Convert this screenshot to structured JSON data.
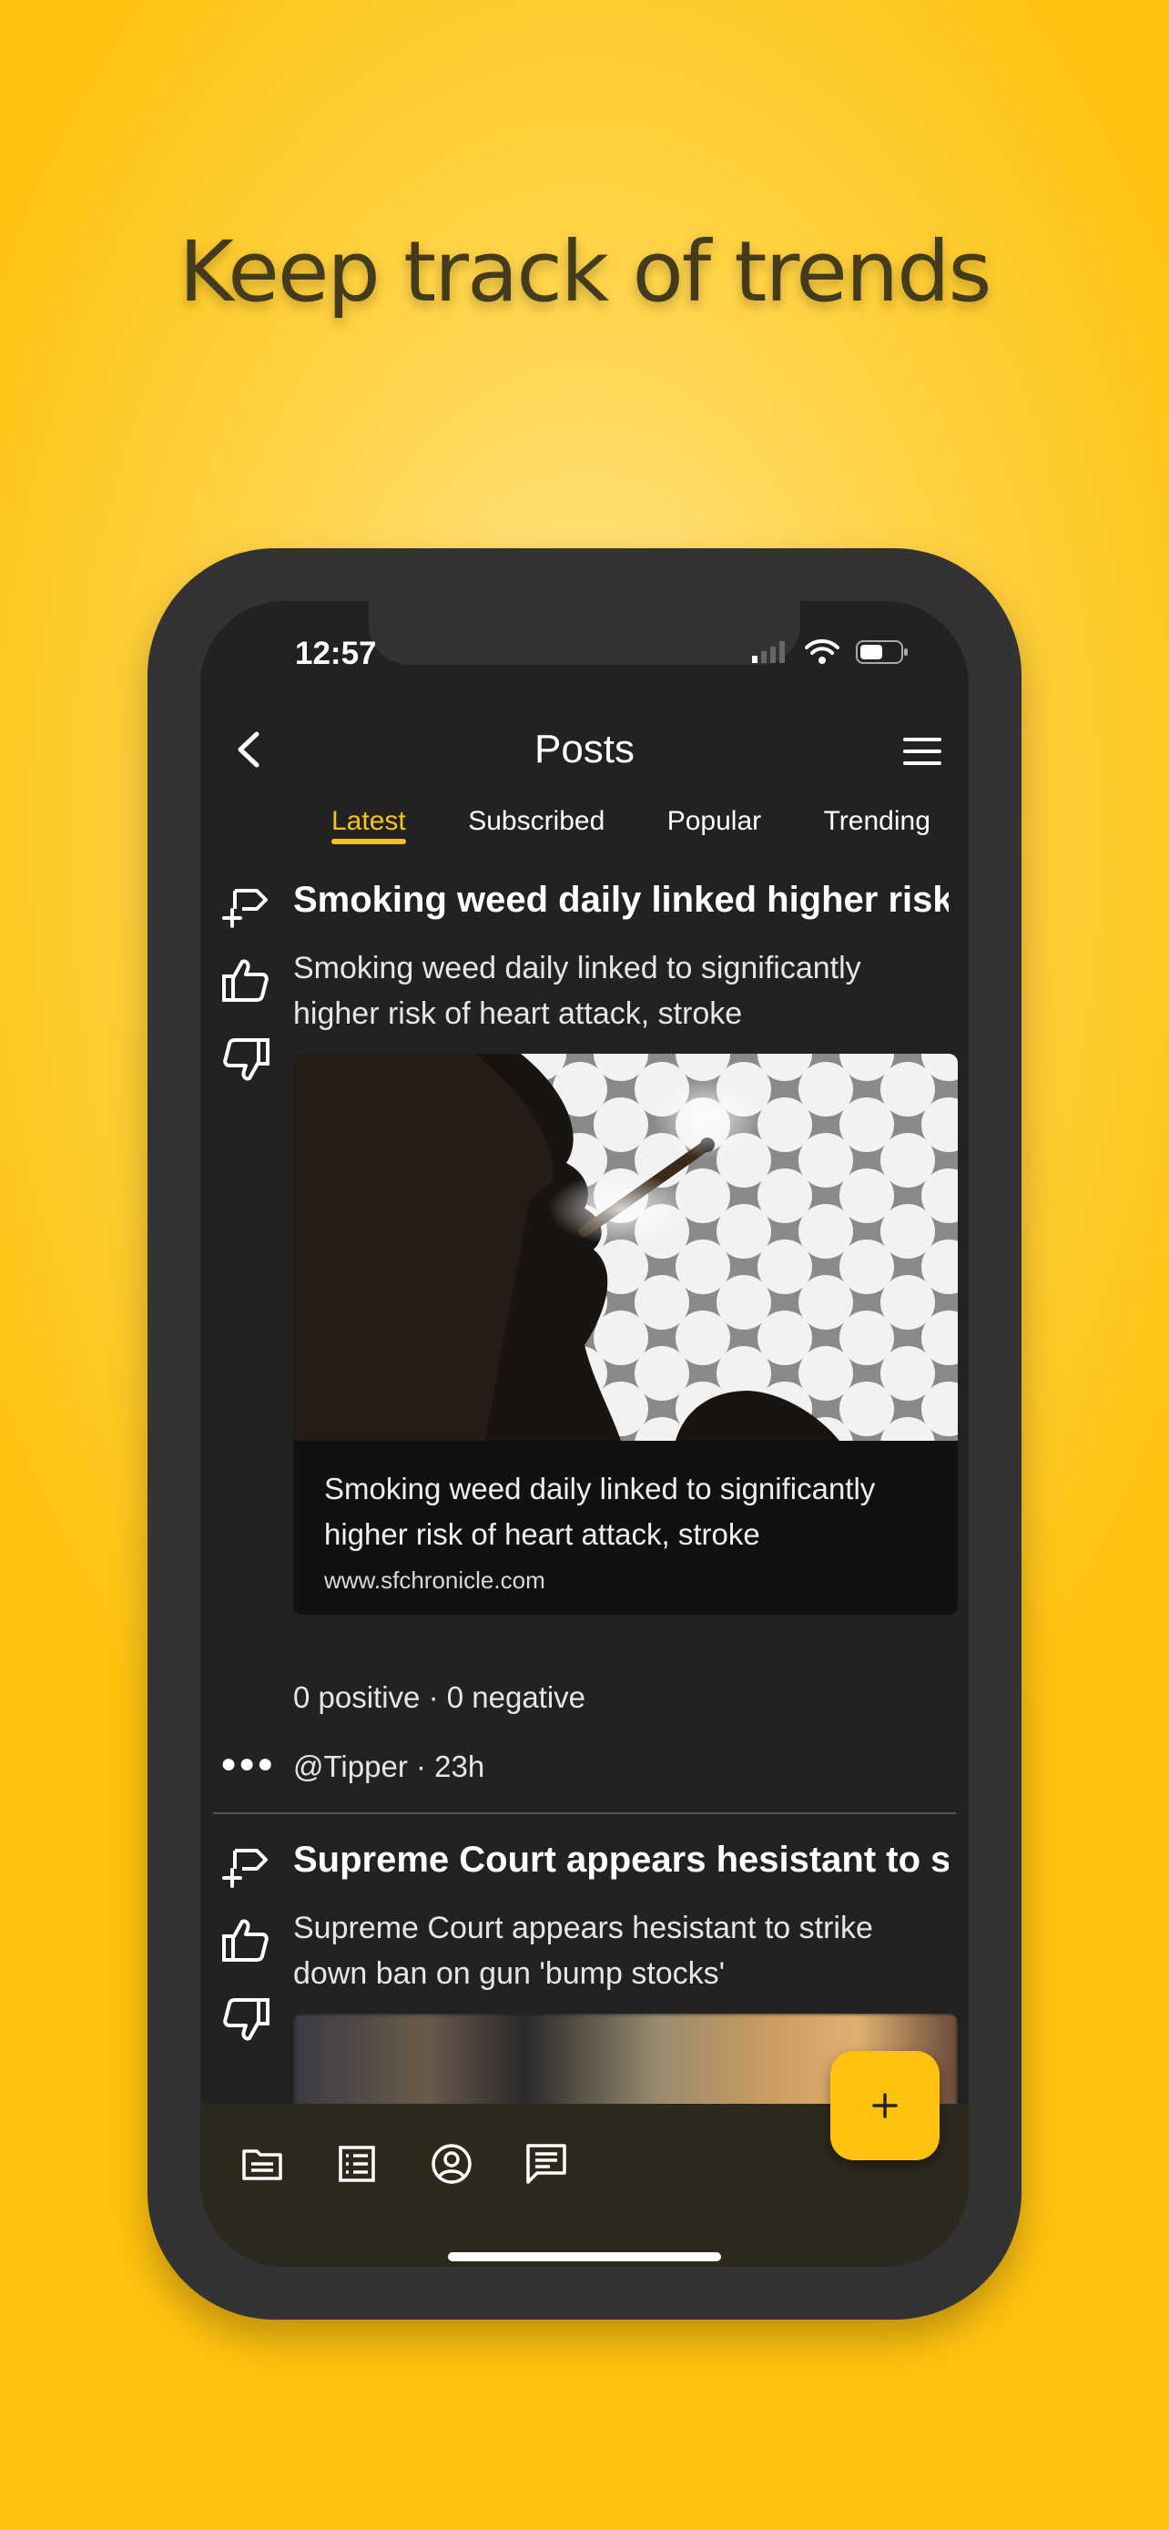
{
  "headline": "Keep track of trends",
  "status": {
    "time": "12:57"
  },
  "nav": {
    "title": "Posts"
  },
  "tabs": [
    {
      "label": "Latest",
      "active": true
    },
    {
      "label": "Subscribed",
      "active": false
    },
    {
      "label": "Popular",
      "active": false
    },
    {
      "label": "Trending",
      "active": false
    }
  ],
  "posts": [
    {
      "title": "Smoking weed daily linked higher risk of heart attack, stroke",
      "body": "Smoking weed daily linked to significantly higher risk of heart attack, stroke",
      "link_title": "Smoking weed daily linked to significantly higher risk of heart attack, stroke",
      "link_domain": "www.sfchronicle.com",
      "score": "0 positive · 0 negative",
      "meta": "@Tipper · 23h"
    },
    {
      "title": "Supreme Court appears hesistant to strike down ban on gun 'bump stocks'",
      "body": "Supreme Court appears hesistant to strike down ban on gun 'bump stocks'"
    }
  ],
  "icons": {
    "side": [
      "reply-icon",
      "thumbs-up-icon",
      "thumbs-down-icon"
    ],
    "bottom": [
      "folder-icon",
      "list-icon",
      "profile-icon",
      "comments-icon"
    ],
    "fab": "plus-icon"
  },
  "colors": {
    "accent": "#fec20f",
    "background": "#222222"
  }
}
